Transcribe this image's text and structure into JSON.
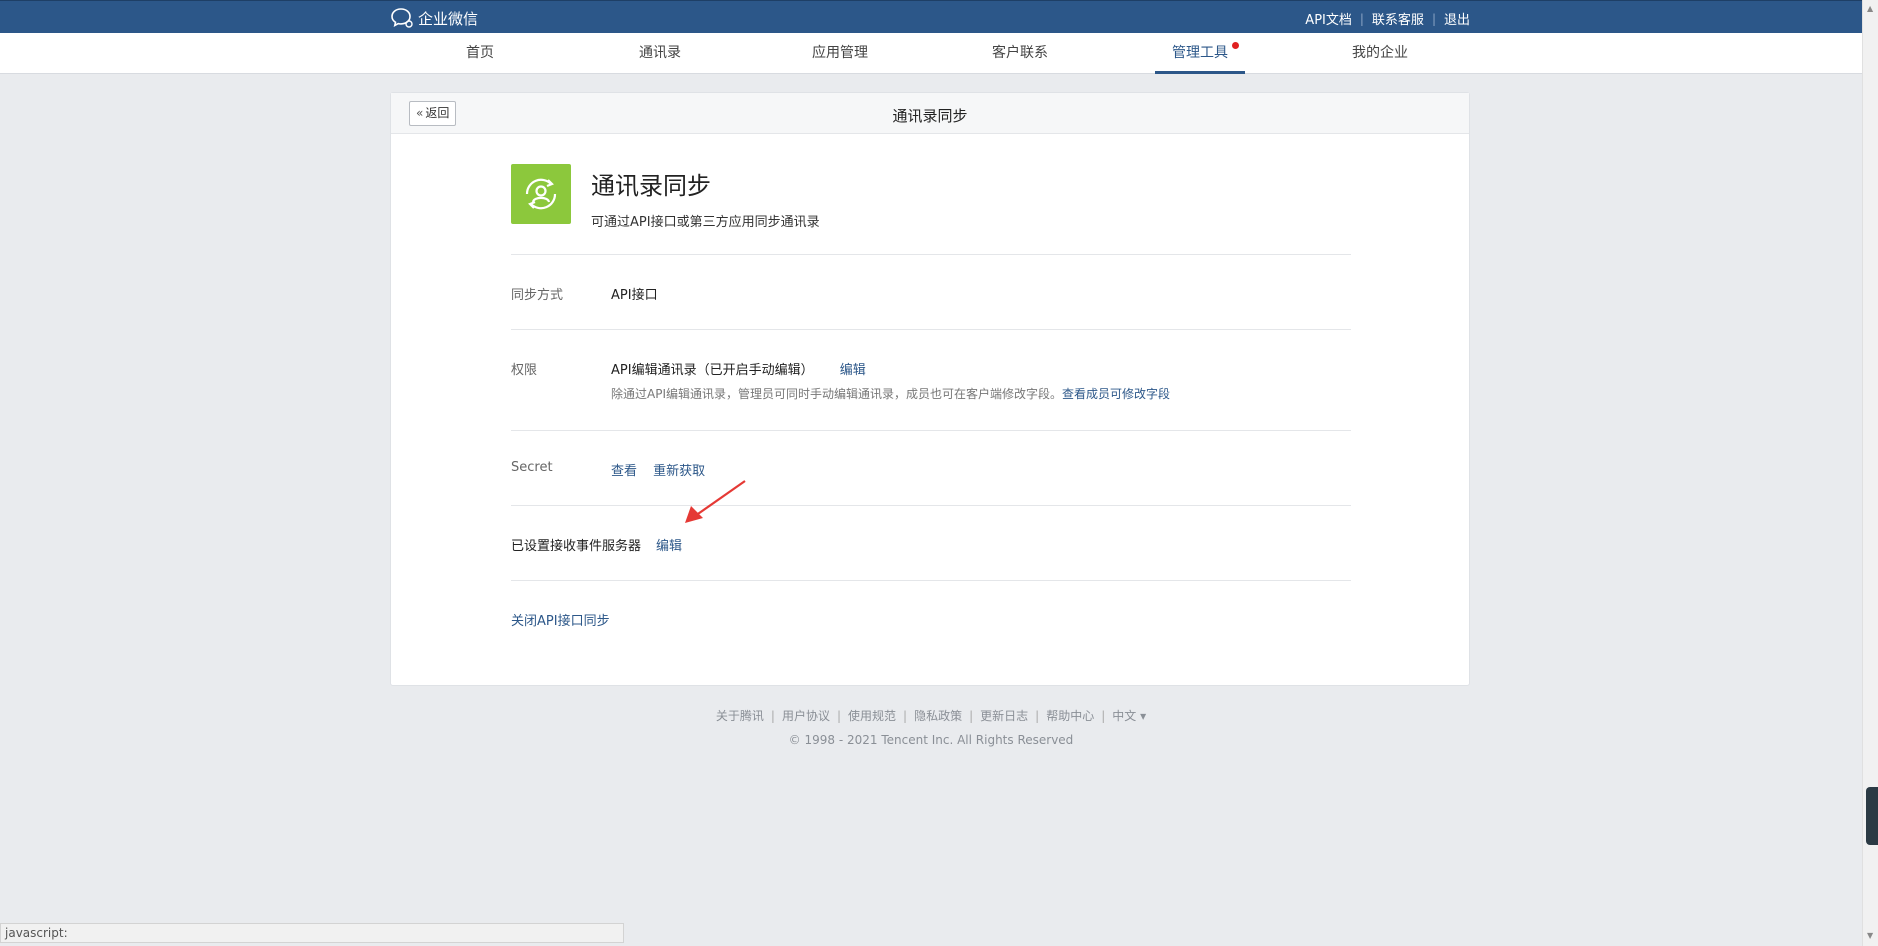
{
  "topbar": {
    "logo_text": "企业微信",
    "links": [
      "API文档",
      "联系客服",
      "退出"
    ],
    "separator": "|"
  },
  "nav": {
    "items": [
      "首页",
      "通讯录",
      "应用管理",
      "客户联系",
      "管理工具",
      "我的企业"
    ],
    "active_index": 4
  },
  "card": {
    "back_label": "返回",
    "title": "通讯录同步",
    "app": {
      "name": "通讯录同步",
      "desc": "可通过API接口或第三方应用同步通讯录"
    },
    "rows": {
      "sync_method": {
        "label": "同步方式",
        "value": "API接口"
      },
      "permission": {
        "label": "权限",
        "value": "API编辑通讯录（已开启手动编辑）",
        "edit": "编辑",
        "hint": "除通过API编辑通讯录，管理员可同时手动编辑通讯录，成员也可在客户端修改字段。",
        "hint_link": "查看成员可修改字段"
      },
      "secret": {
        "label": "Secret",
        "view": "查看",
        "refetch": "重新获取"
      },
      "event_server": {
        "label": "已设置接收事件服务器",
        "edit": "编辑"
      },
      "close_link": "关闭API接口同步"
    }
  },
  "footer": {
    "links": [
      "关于腾讯",
      "用户协议",
      "使用规范",
      "隐私政策",
      "更新日志",
      "帮助中心",
      "中文 ▾"
    ],
    "copyright": "© 1998 - 2021 Tencent Inc. All Rights Reserved"
  },
  "statusbar": {
    "text": "javascript:"
  },
  "colors": {
    "topbar": "#2c5789",
    "app_icon": "#8cc83c",
    "accent": "#2c5789",
    "annotation_arrow": "#e53935"
  }
}
